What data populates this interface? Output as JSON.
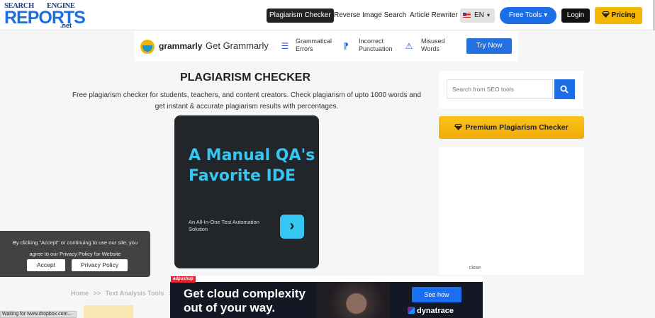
{
  "logo": {
    "line1a": "SEARCH",
    "line1b": "ENGINE",
    "line2": "REPORTS",
    "line3": ".net"
  },
  "nav": {
    "plag": "Plagiarism Checker",
    "rev": "Reverse Image Search",
    "rewriter": "Article Rewriter"
  },
  "lang": {
    "code": "EN",
    "caret": "▾"
  },
  "buttons": {
    "tools": "Free Tools ▾",
    "login": "Login",
    "pricing": "Pricing"
  },
  "grammarly": {
    "name": "grammarly",
    "get": "Get Grammarly",
    "f1a": "Grammatical",
    "f1b": "Errors",
    "f2a": "Incorrect",
    "f2b": "Punctuation",
    "f3a": "Misused",
    "f3b": "Words",
    "cta": "Try Now"
  },
  "main": {
    "title": "PLAGIARISM CHECKER",
    "desc1": "Free plagiarism checker for students, teachers, and content creators. Check plagiarism of upto 1000 words and",
    "desc2": "get instant & accurate plagiarism results with percentages."
  },
  "ad1": {
    "headline1": "A Manual QA's",
    "headline2": "Favorite IDE",
    "sub1": "An All-In-One Test Automation",
    "sub2": "Solution",
    "arrow": "›"
  },
  "sidebar": {
    "placeholder": "Search from SEO tools",
    "premium": "Premium Plagiarism Checker",
    "close": "close"
  },
  "breadcrumb": {
    "home": "Home",
    "sep": ">>",
    "cat": "Text Analysis Tools",
    "sep2": ">>"
  },
  "cookie": {
    "line1": "By clicking \"Accept\" or continuing to use our site, you",
    "line2": "agree to our Privacy Policy for Website",
    "accept": "Accept",
    "privacy": "Privacy Policy"
  },
  "ad2": {
    "tag": "adpushup",
    "line1": "Get cloud complexity",
    "line2": "out of your way.",
    "cta": "See how",
    "brand": "dynatrace"
  },
  "status": "Waiting for www.dropbox.com..."
}
